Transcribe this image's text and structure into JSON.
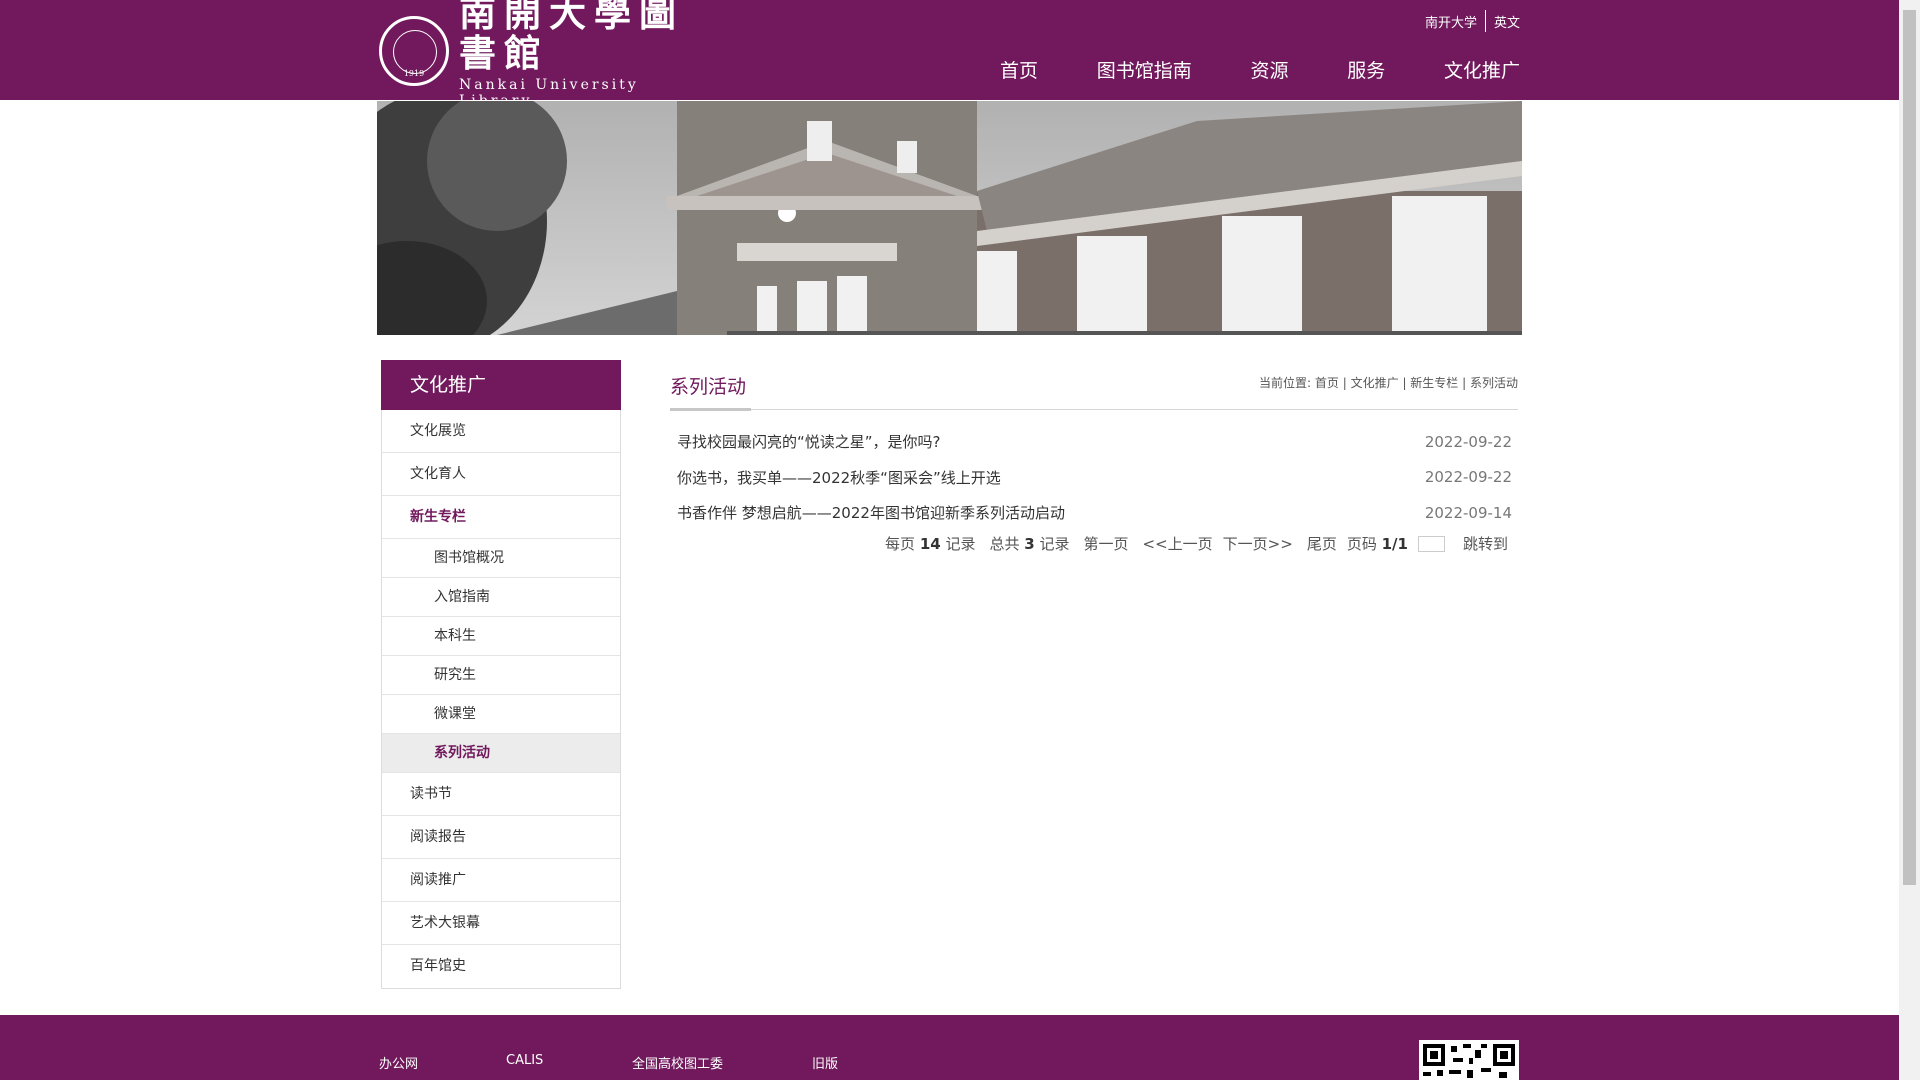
{
  "header": {
    "logo_cn": "南開大學圖書館",
    "logo_en": "Nankai University Library",
    "seal_year": "1919",
    "top_links": [
      "南开大学",
      "英文"
    ],
    "nav": [
      "首页",
      "图书馆指南",
      "资源",
      "服务",
      "文化推广"
    ]
  },
  "sidebar": {
    "title": "文化推广",
    "items": [
      {
        "label": "文化展览"
      },
      {
        "label": "文化育人"
      },
      {
        "label": "新生专栏"
      },
      {
        "label": "读书节"
      },
      {
        "label": "阅读报告"
      },
      {
        "label": "阅读推广"
      },
      {
        "label": "艺术大银幕"
      },
      {
        "label": "百年馆史"
      }
    ],
    "sub_items": [
      {
        "label": "图书馆概况"
      },
      {
        "label": "入馆指南"
      },
      {
        "label": "本科生"
      },
      {
        "label": "研究生"
      },
      {
        "label": "微课堂"
      },
      {
        "label": "系列活动"
      }
    ]
  },
  "content": {
    "title": "系列活动",
    "breadcrumb": {
      "prefix": "当前位置:",
      "items": [
        "首页",
        "文化推广",
        "新生专栏",
        "系列活动"
      ]
    },
    "news": [
      {
        "title": "寻找校园最闪亮的“悦读之星”，是你吗?",
        "date": "2022-09-22"
      },
      {
        "title": "你选书，我买单——2022秋季“图采会”线上开选",
        "date": "2022-09-22"
      },
      {
        "title": "书香作伴 梦想启航——2022年图书馆迎新季系列活动启动",
        "date": "2022-09-14"
      }
    ],
    "pager": {
      "per_page_prefix": "每页",
      "per_page": "14",
      "records_label": "记录",
      "total_prefix": "总共",
      "total": "3",
      "first": "第一页",
      "prev": "<<上一页",
      "next": "下一页>>",
      "last": "尾页",
      "page_label": "页码",
      "page": "1/1",
      "jump": "跳转到"
    }
  },
  "footer": {
    "links": [
      "办公网",
      "CALIS",
      "全国高校图工委",
      "旧版"
    ]
  },
  "colors": {
    "brand": "#71195c",
    "sub_active_bg": "#ececec"
  }
}
